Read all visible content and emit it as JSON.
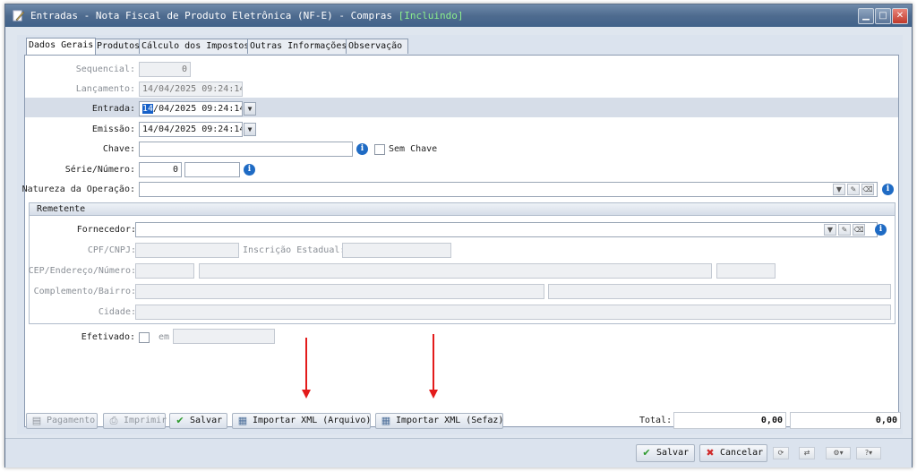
{
  "window": {
    "title": "Entradas - Nota Fiscal de Produto Eletrônica (NF-E) - Compras",
    "state": "[Incluindo]"
  },
  "tabs": [
    "Dados Gerais",
    "Produtos",
    "Cálculo dos Impostos",
    "Outras Informações",
    "Observação"
  ],
  "form": {
    "sequencial_label": "Sequencial:",
    "sequencial_value": "0",
    "lancamento_label": "Lançamento:",
    "lancamento_value": "14/04/2025 09:24:14",
    "entrada_label": "Entrada:",
    "entrada_sel": "14",
    "entrada_rest": "/04/2025 09:24:14",
    "emissao_label": "Emissão:",
    "emissao_value": "14/04/2025 09:24:14",
    "chave_label": "Chave:",
    "chave_value": "",
    "sem_chave_label": "Sem Chave",
    "serie_label": "Série/Número:",
    "serie_value": "0",
    "numero_value": "",
    "natureza_label": "Natureza da Operação:",
    "natureza_value": ""
  },
  "remetente": {
    "header": "Remetente",
    "fornecedor_label": "Fornecedor:",
    "cpf_label": "CPF/CNPJ:",
    "ie_label": "Inscrição Estadual:",
    "cep_label": "CEP/Endereço/Número:",
    "complemento_label": "Complemento/Bairro:",
    "cidade_label": "Cidade:"
  },
  "efetivado": {
    "label": "Efetivado:",
    "em_label": "em"
  },
  "actions": {
    "pagamento": "Pagamento",
    "imprimir": "Imprimir",
    "salvar": "Salvar",
    "importar_arquivo": "Importar XML (Arquivo)",
    "importar_sefaz": "Importar XML (Sefaz)",
    "total_label": "Total:",
    "total_1": "0,00",
    "total_2": "0,00"
  },
  "footer": {
    "salvar": "Salvar",
    "cancelar": "Cancelar"
  }
}
